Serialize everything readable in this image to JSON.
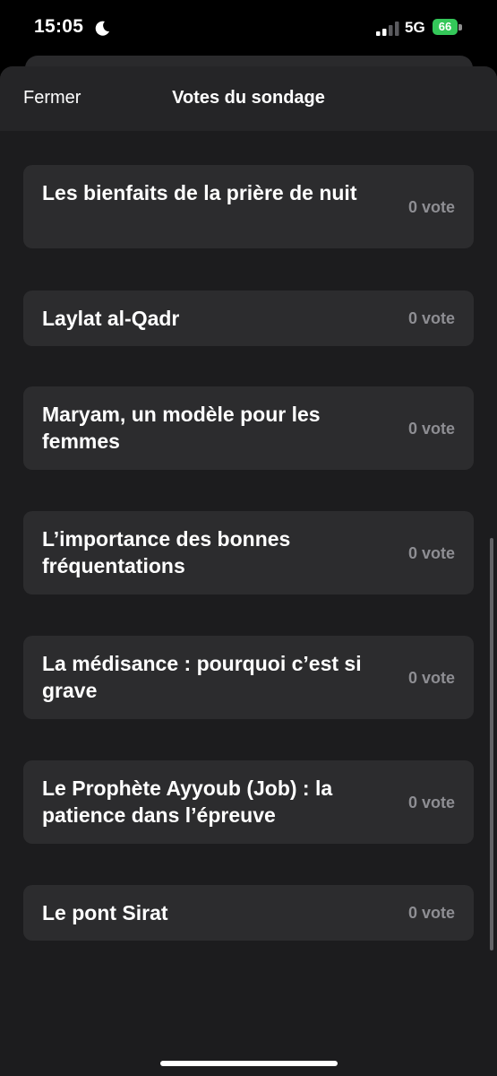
{
  "status_bar": {
    "time": "15:05",
    "network": "5G",
    "battery": "66"
  },
  "sheet": {
    "close_label": "Fermer",
    "title": "Votes du sondage"
  },
  "options": [
    {
      "label": "Les bienfaits de la prière de nuit",
      "count": "0 vote"
    },
    {
      "label": "Laylat al-Qadr",
      "count": "0 vote"
    },
    {
      "label": "Maryam, un modèle pour les femmes",
      "count": "0 vote"
    },
    {
      "label": "L’importance des bonnes fréquentations",
      "count": "0 vote"
    },
    {
      "label": "La médisance : pourquoi c’est si grave",
      "count": "0 vote"
    },
    {
      "label": "Le Prophète Ayyoub (Job) : la patience dans l’épreuve",
      "count": "0 vote"
    },
    {
      "label": "Le pont Sirat",
      "count": "0 vote"
    }
  ],
  "colors": {
    "background": "#000000",
    "sheet": "#1c1c1e",
    "card": "#2c2c2e",
    "battery": "#34c759",
    "muted_text": "#8e8e93"
  }
}
